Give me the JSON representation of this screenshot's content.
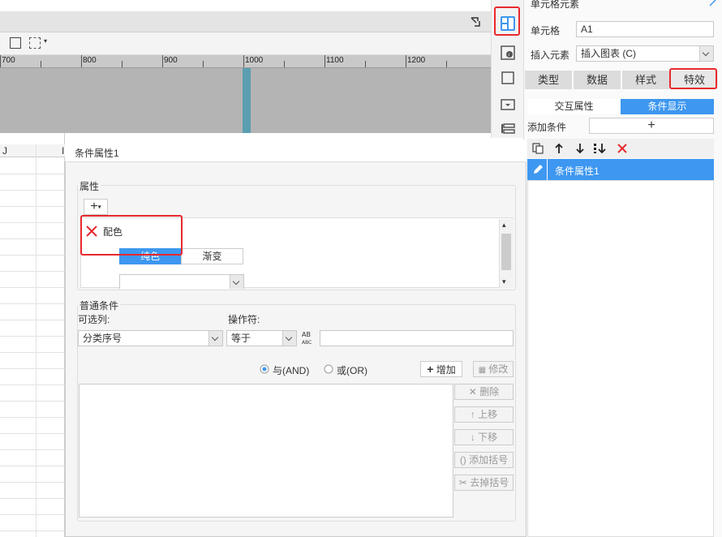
{
  "ruler": {
    "labels": [
      "700",
      "800",
      "900",
      "1000",
      "1100",
      "1200"
    ]
  },
  "sheet": {
    "column_label": "J",
    "column_label_2": "I"
  },
  "panel": {
    "header": "单元格元素",
    "cell_label": "单元格",
    "cell_value": "A1",
    "insert_label": "插入元素",
    "insert_value": "插入图表 (C)",
    "tabs": [
      "类型",
      "数据",
      "样式",
      "特效"
    ],
    "active_tab": "特效",
    "subtabs": [
      "交互属性",
      "条件显示"
    ],
    "add_condition_label": "添加条件",
    "add_condition_plus": "+",
    "condition_items": [
      "条件属性1"
    ]
  },
  "dialog": {
    "title": "条件属性1",
    "attr_group_label": "属性",
    "attr_add": "+",
    "attr_item": "配色",
    "color_tabs": [
      "纯色",
      "渐变"
    ],
    "common_group_label": "普通条件",
    "column_label": "可选列:",
    "operator_label": "操作符:",
    "column_value": "分类序号",
    "operator_value": "等于",
    "logic_and": "与(AND)",
    "logic_or": "或(OR)",
    "add_button": "增加",
    "modify_button": "修改",
    "side_buttons": [
      "删除",
      "上移",
      "下移",
      "添加括号",
      "去掉括号"
    ]
  },
  "colors": {
    "accent": "#3e97f0",
    "highlight": "#e8292d"
  }
}
